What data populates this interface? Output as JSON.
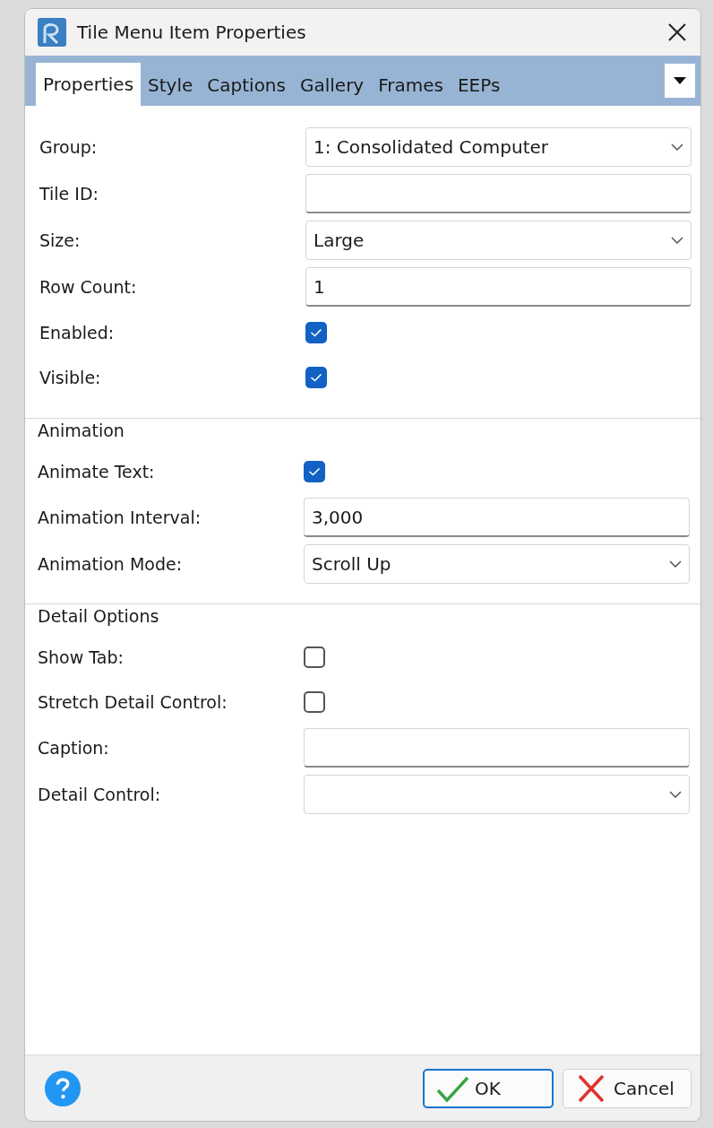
{
  "window": {
    "title": "Tile Menu Item Properties"
  },
  "tabs": [
    {
      "label": "Properties",
      "selected": true
    },
    {
      "label": "Style",
      "selected": false
    },
    {
      "label": "Captions",
      "selected": false
    },
    {
      "label": "Gallery",
      "selected": false
    },
    {
      "label": "Frames",
      "selected": false
    },
    {
      "label": "EEPs",
      "selected": false
    }
  ],
  "sections": [
    {
      "fields": [
        {
          "kind": "select",
          "label": "Group:",
          "value": "1: Consolidated Computer"
        },
        {
          "kind": "text",
          "label": "Tile ID:"
        },
        {
          "kind": "select",
          "label": "Size:",
          "value": "Large"
        },
        {
          "kind": "text",
          "label": "Row Count:",
          "value": "1"
        },
        {
          "kind": "checkbox",
          "label": "Enabled:",
          "checked": true
        },
        {
          "kind": "checkbox",
          "label": "Visible:",
          "checked": true
        }
      ]
    },
    {
      "title": "Animation",
      "fields": [
        {
          "kind": "checkbox",
          "label": "Animate Text:",
          "checked": true
        },
        {
          "kind": "text",
          "label": "Animation Interval:",
          "value": "3,000"
        },
        {
          "kind": "select",
          "label": "Animation Mode:",
          "value": "Scroll Up"
        }
      ]
    },
    {
      "title": "Detail Options",
      "fields": [
        {
          "kind": "checkbox",
          "label": "Show Tab:",
          "checked": false
        },
        {
          "kind": "checkbox",
          "label": "Stretch Detail Control:",
          "checked": false
        },
        {
          "kind": "text",
          "label": "Caption:"
        },
        {
          "kind": "select",
          "label": "Detail Control:"
        }
      ]
    }
  ],
  "buttons": [
    {
      "kind": "ok",
      "label": "OK",
      "focused": true
    },
    {
      "kind": "cancel",
      "label": "Cancel",
      "focused": false
    }
  ]
}
